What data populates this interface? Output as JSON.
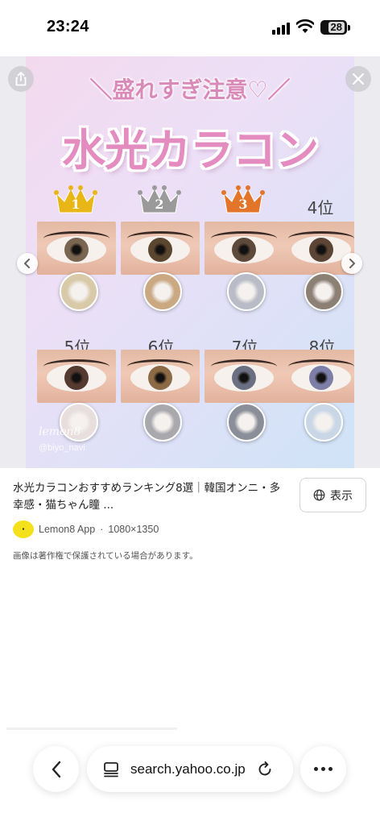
{
  "status_bar": {
    "time": "23:24",
    "battery": "28"
  },
  "poster": {
    "subtitle": "＼盛れすぎ注意♡／",
    "title": "水光カラコン",
    "ranks": [
      {
        "label": "1",
        "kind": "crown",
        "crown_color": "#e8b617",
        "iris": "#7a6650",
        "lens": "#d8c9a8"
      },
      {
        "label": "2",
        "kind": "crown",
        "crown_color": "#9a9a9a",
        "iris": "#5b4630",
        "lens": "#c9a882"
      },
      {
        "label": "3",
        "kind": "crown",
        "crown_color": "#e2752a",
        "iris": "#5e4a3a",
        "lens": "#b9bcc6"
      },
      {
        "label": "4位",
        "kind": "text",
        "iris": "#5c4535",
        "lens": "#8c7f74"
      },
      {
        "label": "5位",
        "kind": "text",
        "iris": "#553a30",
        "lens": "#e8dede"
      },
      {
        "label": "6位",
        "kind": "text",
        "iris": "#8c6a45",
        "lens": "#a9a9ad"
      },
      {
        "label": "7位",
        "kind": "text",
        "iris": "#6a7082",
        "lens": "#8a8e98"
      },
      {
        "label": "8位",
        "kind": "text",
        "iris": "#7d7fa8",
        "lens": "#c8d6e6"
      }
    ],
    "watermark": "lemon8",
    "handle": "@biyo_navi"
  },
  "info": {
    "title": "水光カラコンおすすめランキング8選｜韓国オンニ・多幸感・猫ちゃん瞳 ...",
    "view_button": "表示",
    "source_name": "Lemon8 App",
    "separator": "·",
    "dimensions": "1080×1350",
    "copyright_notice": "画像は著作権で保護されている場合があります。"
  },
  "toolbar": {
    "url": "search.yahoo.co.jp"
  }
}
